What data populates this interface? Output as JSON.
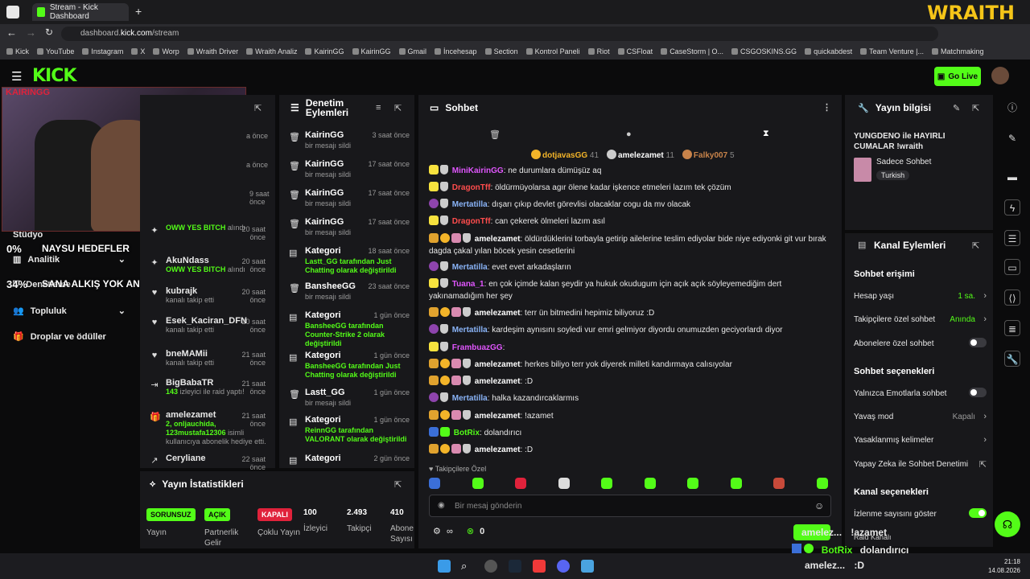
{
  "browser": {
    "tab_title": "Stream - Kick Dashboard",
    "url_prefix": "dashboard.",
    "url_host": "kick.com",
    "url_path": "/stream",
    "bookmarks": [
      "Kick",
      "YouTube",
      "Instagram",
      "X",
      "Worp",
      "Wraith Driver",
      "Wraith Analiz",
      "KairinGG",
      "KairinGG",
      "Gmail",
      "İncehesap",
      "Section",
      "Kontrol Paneli",
      "Riot",
      "CSFloat",
      "CaseStorm | O...",
      "CSGOSKINS.GG",
      "quickabdest",
      "Team Venture |...",
      "Matchmaking"
    ]
  },
  "overlay": {
    "wraith": "WRAITH",
    "cam_name": "KAIRINGG",
    "goal1_pct": "0%",
    "goal1_text": "NAYSU HEDEFLER",
    "goal2_pct": "34%",
    "goal2_text": "SANA ALKIŞ YOK ANCA KICK",
    "bottom_user1": "amelez...",
    "bottom_text1": "!azamet",
    "bottom_user2": "BotRix",
    "bottom_text2": "dolandırıcı",
    "bottom_user3": "amelez...",
    "bottom_text3": ":D",
    "raid_label": "Raid Kanalı"
  },
  "header": {
    "logo": "KICK",
    "go_live": "Go Live"
  },
  "nav": {
    "items": [
      "Stüdyo",
      "Analitik",
      "Denetleme",
      "Topluluk",
      "Droplar ve ödüller"
    ]
  },
  "events": [
    {
      "name": "",
      "desc": "OWW YES BITCH",
      "desc2": "alındı",
      "time": "20 saat önce"
    },
    {
      "name": "AkuNdass",
      "desc": "OWW YES BITCH",
      "desc2": "alındı",
      "time": "20 saat önce"
    },
    {
      "name": "kubrajk",
      "desc": "kanalı takip etti",
      "desc2": "",
      "time": "20 saat önce"
    },
    {
      "name": "Esek_Kaciran_DFN",
      "desc": "kanalı takip etti",
      "desc2": "",
      "time": "20 saat önce"
    },
    {
      "name": "bneMAMii",
      "desc": "kanalı takip etti",
      "desc2": "",
      "time": "21 saat önce"
    },
    {
      "name": "BigBabaTR",
      "desc": "143",
      "desc2": "izleyici ile raid yaptı!",
      "time": "21 saat önce"
    },
    {
      "name": "amelezamet",
      "desc": "2, onljauchida, 123mustafa12306",
      "desc2": "isimli kullanıcıya abonelik hediye etti.",
      "time": "21 saat önce"
    },
    {
      "name": "Ceryliane",
      "desc": "",
      "desc2": "",
      "time": "22 saat önce"
    }
  ],
  "events_times_top": [
    "a önce",
    "a önce",
    "9 saat önce"
  ],
  "moderation": {
    "title": "Denetim Eylemleri",
    "items": [
      {
        "name": "KairinGG",
        "desc": "bir mesajı sildi",
        "time": "3 saat önce"
      },
      {
        "name": "KairinGG",
        "desc": "bir mesajı sildi",
        "time": "17 saat önce"
      },
      {
        "name": "KairinGG",
        "desc": "bir mesajı sildi",
        "time": "17 saat önce"
      },
      {
        "name": "KairinGG",
        "desc": "bir mesajı sildi",
        "time": "17 saat önce"
      },
      {
        "name": "Kategori",
        "desc": "Lastt_GG tarafından Just Chatting olarak değiştirildi",
        "time": "18 saat önce"
      },
      {
        "name": "BansheeGG",
        "desc": "bir mesajı sildi",
        "time": "23 saat önce"
      },
      {
        "name": "Kategori",
        "desc": "BansheeGG tarafından Counter-Strike 2 olarak değiştirildi",
        "time": "1 gün önce"
      },
      {
        "name": "Kategori",
        "desc": "BansheeGG tarafından Just Chatting olarak değiştirildi",
        "time": "1 gün önce"
      },
      {
        "name": "Lastt_GG",
        "desc": "bir mesajı sildi",
        "time": "1 gün önce"
      },
      {
        "name": "Kategori",
        "desc": "ReinnGG tarafından VALORANT olarak değiştirildi",
        "time": "1 gün önce"
      },
      {
        "name": "Kategori",
        "desc": "",
        "time": "2 gün önce"
      }
    ]
  },
  "chat": {
    "title": "Sohbet",
    "top_gifters": [
      {
        "name": "dotjavasGG",
        "count": "41"
      },
      {
        "name": "amelezamet",
        "count": "11"
      },
      {
        "name": "Falky007",
        "count": "5"
      }
    ],
    "messages": [
      {
        "user": "MiniKairinGG",
        "color": "#e056fd",
        "text": "ne durumlara dümüşüz aq"
      },
      {
        "user": "DragonTff",
        "color": "#ff4d4d",
        "text": "öldürmüyolarsa agır ölene kadar işkence etmeleri lazım tek çözüm"
      },
      {
        "user": "Mertatilla",
        "color": "#8ab4f8",
        "text": "dışarı çıkıp devlet görevlisi olacaklar cogu da mv olacak"
      },
      {
        "user": "DragonTff",
        "color": "#ff4d4d",
        "text": "can çekerek ölmeleri lazım asıl"
      },
      {
        "user": "amelezamet",
        "color": "#ffffff",
        "text": "öldürdüklerini torbayla getirip ailelerine teslim ediyolar bide niye ediyonki git vur bırak dagda çakal yılan böcek yesin cesetlerini"
      },
      {
        "user": "Mertatilla",
        "color": "#8ab4f8",
        "text": "evet evet arkadaşların"
      },
      {
        "user": "Tuana_1",
        "color": "#e056fd",
        "text": "en çok içimde kalan şeydir ya hukuk okudugum için açık açık söyleyemediğim dert yakınamadığım her şey"
      },
      {
        "user": "amelezamet",
        "color": "#ffffff",
        "text": "terr ün bitmedini hepimiz biliyoruz :D"
      },
      {
        "user": "Mertatilla",
        "color": "#8ab4f8",
        "text": "kardeşim aynısını soyledi vur emri gelmiyor diyordu onumuzden geciyorlardı diyor"
      },
      {
        "user": "FrambuazGG",
        "color": "#e056fd",
        "text": ""
      },
      {
        "user": "amelezamet",
        "color": "#ffffff",
        "text": "herkes biliyo terr yok diyerek milleti kandırmaya calısıyolar"
      },
      {
        "user": "amelezamet",
        "color": "#ffffff",
        "text": ":D"
      },
      {
        "user": "Mertatilla",
        "color": "#8ab4f8",
        "text": "halka kazandırcaklarmıs"
      },
      {
        "user": "amelezamet",
        "color": "#ffffff",
        "text": "!azamet"
      },
      {
        "user": "BotRix",
        "color": "#53fc18",
        "text": "dolandırıcı"
      },
      {
        "user": "amelezamet",
        "color": "#ffffff",
        "text": ":D"
      }
    ],
    "followers_only": "Takipçilere Özel",
    "input_placeholder": "Bir mesaj gönderin",
    "points": "0"
  },
  "stream_info": {
    "title": "Yayın bilgisi",
    "stream_title": "YUNGDENO ile HAYIRLI CUMALAR !wraith",
    "category": "Sadece Sohbet",
    "language": "Turkish"
  },
  "channel_actions": {
    "title": "Kanal Eylemleri",
    "chat_access": "Sohbet erişimi",
    "account_age": "Hesap yaşı",
    "account_age_value": "1 sa.",
    "followers_chat": "Takipçilere özel sohbet",
    "followers_chat_value": "Anında",
    "subs_chat": "Abonelere özel sohbet",
    "chat_options": "Sohbet seçenekleri",
    "emote_only": "Yalnızca Emotlarla sohbet",
    "slow_mode": "Yavaş mod",
    "slow_mode_value": "Kapalı",
    "banned_words": "Yasaklanmış kelimeler",
    "ai_moderation": "Yapay Zeka ile Sohbet Denetimi",
    "channel_options": "Kanal seçenekleri",
    "show_viewers": "İzlenme sayısını göster"
  },
  "stats": {
    "title": "Yayın İstatistikleri",
    "items": [
      {
        "chip": "SORUNSUZ",
        "label": "Yayın",
        "color": "#53fc18"
      },
      {
        "chip": "AÇIK",
        "label": "Partnerlik Gelir",
        "color": "#53fc18"
      },
      {
        "chip": "KAPALI",
        "label": "Çoklu Yayın",
        "color": "#e0223b"
      },
      {
        "chip": "100",
        "label": "İzleyici",
        "color": ""
      },
      {
        "chip": "2.493",
        "label": "Takipçi",
        "color": ""
      },
      {
        "chip": "410",
        "label": "Abone Sayısı",
        "color": ""
      }
    ]
  },
  "taskbar": {
    "time": "21:18",
    "date": "14.08.2026"
  }
}
